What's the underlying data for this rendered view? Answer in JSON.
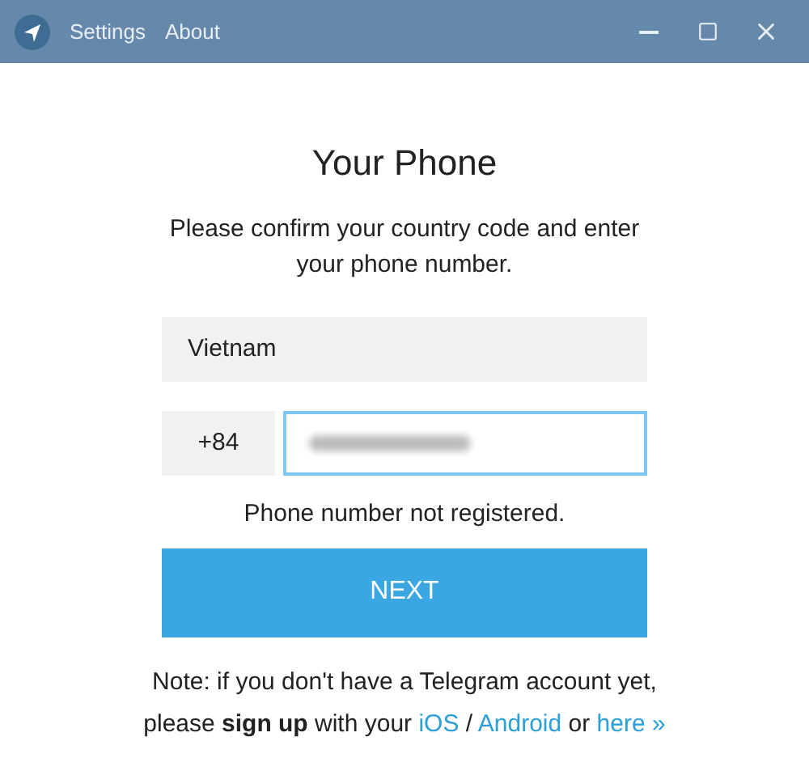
{
  "titlebar": {
    "menu": [
      "Settings",
      "About"
    ]
  },
  "title": "Your Phone",
  "description": "Please confirm your country code and enter your phone number.",
  "country": {
    "value": "Vietnam"
  },
  "phone": {
    "code": "+84",
    "focused": true,
    "redacted": true
  },
  "error": "Phone number not registered.",
  "next_button": "NEXT",
  "note": [
    {
      "kind": "text",
      "text": "Note: if you don't have a Telegram account yet, please **sign up** with your "
    },
    {
      "kind": "link",
      "text": "iOS"
    },
    {
      "kind": "text",
      "text": " / "
    },
    {
      "kind": "link",
      "text": "Android"
    },
    {
      "kind": "text",
      "text": " or "
    },
    {
      "kind": "link",
      "text": "here »"
    }
  ]
}
